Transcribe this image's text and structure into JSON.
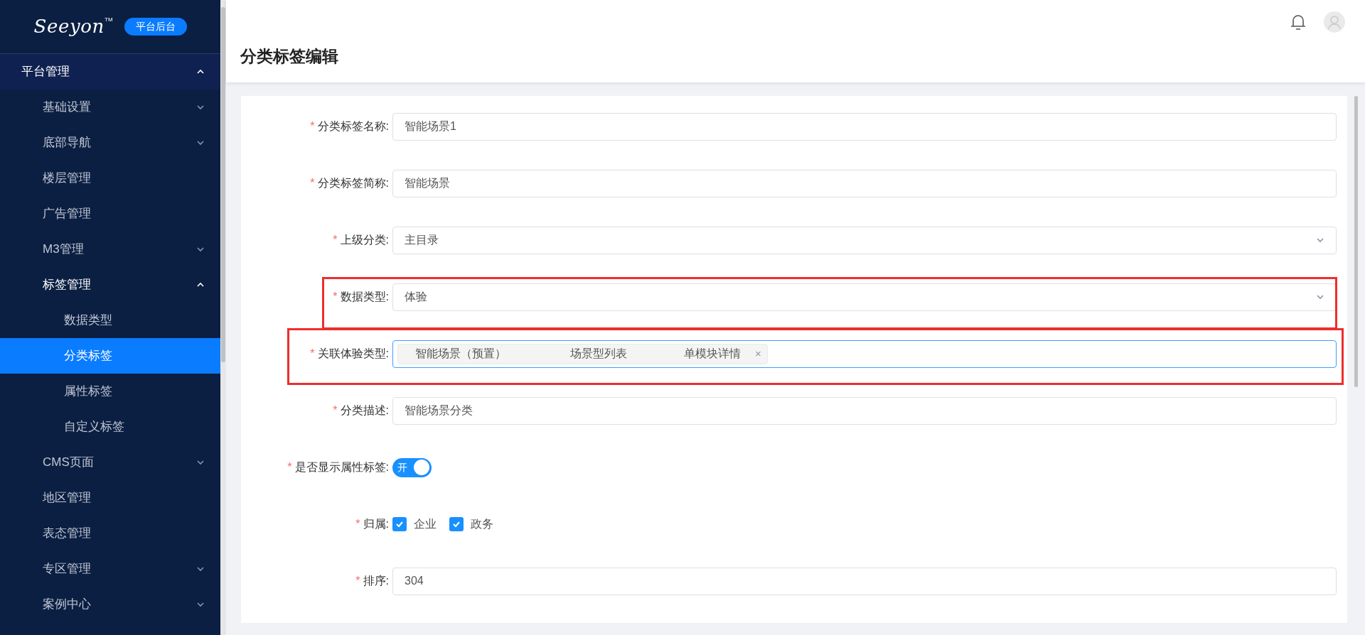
{
  "sidebar": {
    "brand": "Seeyon",
    "brand_mark": "TM",
    "badge": "平台后台",
    "items": [
      {
        "label": "平台管理",
        "expanded": true,
        "children": [
          {
            "label": "基础设置",
            "expanded": false
          },
          {
            "label": "底部导航",
            "expanded": false
          },
          {
            "label": "楼层管理"
          },
          {
            "label": "广告管理"
          },
          {
            "label": "M3管理",
            "expanded": false
          },
          {
            "label": "标签管理",
            "expanded": true,
            "children": [
              {
                "label": "数据类型",
                "selected": false
              },
              {
                "label": "分类标签",
                "selected": true
              },
              {
                "label": "属性标签",
                "selected": false
              },
              {
                "label": "自定义标签",
                "selected": false
              }
            ]
          },
          {
            "label": "CMS页面",
            "expanded": false
          },
          {
            "label": "地区管理"
          },
          {
            "label": "表态管理"
          },
          {
            "label": "专区管理",
            "expanded": false
          },
          {
            "label": "案例中心",
            "expanded": false
          }
        ]
      }
    ]
  },
  "page": {
    "title": "分类标签编辑"
  },
  "form": {
    "fields": [
      {
        "kind": "text",
        "required": "*",
        "label": "分类标签名称:",
        "value": "智能场景1",
        "highlighted": false
      },
      {
        "kind": "text",
        "required": "*",
        "label": "分类标签简称:",
        "value": "智能场景",
        "highlighted": false
      },
      {
        "kind": "select",
        "required": "*",
        "label": "上级分类:",
        "value": "主目录",
        "highlighted": false
      },
      {
        "kind": "select",
        "required": "*",
        "label": "数据类型:",
        "value": "体验",
        "highlighted": true
      },
      {
        "kind": "tags",
        "required": "*",
        "label": "关联体验类型:",
        "tags": [
          "智能场景（预置）",
          "场景型列表",
          "单模块详情"
        ],
        "close": "×",
        "focused": true,
        "highlighted": true
      },
      {
        "kind": "text",
        "required": "*",
        "label": "分类描述:",
        "value": "智能场景分类",
        "highlighted": false
      },
      {
        "kind": "switch",
        "required": "*",
        "label": "是否显示属性标签:",
        "on": true,
        "on_text": "开"
      },
      {
        "kind": "checks",
        "required": "*",
        "label": "归属:",
        "options": [
          {
            "label": "企业",
            "checked": true
          },
          {
            "label": "政务",
            "checked": true
          }
        ]
      },
      {
        "kind": "text",
        "required": "*",
        "label": "排序:",
        "value": "304",
        "highlighted": false
      }
    ]
  }
}
